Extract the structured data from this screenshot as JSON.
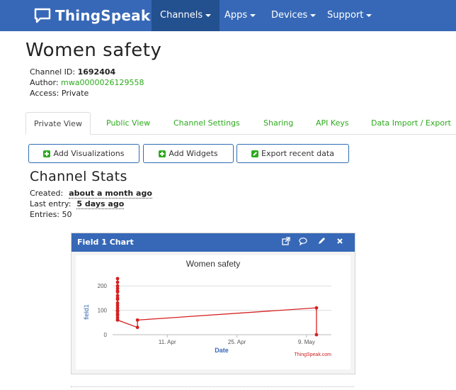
{
  "navbar": {
    "brand": "ThingSpeak",
    "brand_tm": "™",
    "items": [
      {
        "label": "Channels"
      },
      {
        "label": "Apps"
      },
      {
        "label": "Devices"
      },
      {
        "label": "Support"
      }
    ]
  },
  "channel": {
    "title": "Women safety",
    "id_label": "Channel ID:",
    "id_value": "1692404",
    "author_label": "Author:",
    "author_value": "mwa0000026129558",
    "access_label": "Access:",
    "access_value": "Private"
  },
  "tabs": [
    {
      "label": "Private View"
    },
    {
      "label": "Public View"
    },
    {
      "label": "Channel Settings"
    },
    {
      "label": "Sharing"
    },
    {
      "label": "API Keys"
    },
    {
      "label": "Data Import / Export"
    }
  ],
  "buttons": {
    "add_visualizations": "Add Visualizations",
    "add_widgets": "Add Widgets",
    "export_recent": "Export recent data"
  },
  "stats": {
    "title": "Channel Stats",
    "created_label": "Created:",
    "created_value": "about a month ago",
    "last_entry_label": "Last entry:",
    "last_entry_value": "5 days ago",
    "entries_label": "Entries:",
    "entries_value": "50"
  },
  "widget": {
    "title": "Field 1 Chart",
    "icons": [
      "external-link-icon",
      "comment-icon",
      "pencil-icon",
      "close-icon"
    ]
  },
  "chart_data": {
    "type": "line",
    "title": "Women safety",
    "xlabel": "Date",
    "ylabel": "field1",
    "credit": "ThingSpeak.com",
    "xticks": [
      "11. Apr",
      "25. Apr",
      "9. May"
    ],
    "yticks": [
      0,
      100,
      200
    ],
    "ylim": [
      0,
      250
    ],
    "xlim": [
      "2022-03-31",
      "2022-05-14"
    ],
    "line_color": "#d62020",
    "series": [
      {
        "x": [
          "2022-04-01",
          "2022-04-01",
          "2022-04-01",
          "2022-04-01",
          "2022-04-01",
          "2022-04-01",
          "2022-04-01",
          "2022-04-01",
          "2022-04-01",
          "2022-04-01",
          "2022-04-01",
          "2022-04-01",
          "2022-04-01",
          "2022-04-01",
          "2022-04-01",
          "2022-04-01",
          "2022-04-01",
          "2022-04-01",
          "2022-04-01",
          "2022-04-05",
          "2022-04-05",
          "2022-05-11",
          "2022-05-11"
        ],
        "y": [
          230,
          215,
          200,
          190,
          175,
          160,
          145,
          130,
          120,
          110,
          100,
          95,
          85,
          80,
          70,
          60,
          150,
          180,
          60,
          30,
          60,
          110,
          0
        ]
      }
    ]
  }
}
